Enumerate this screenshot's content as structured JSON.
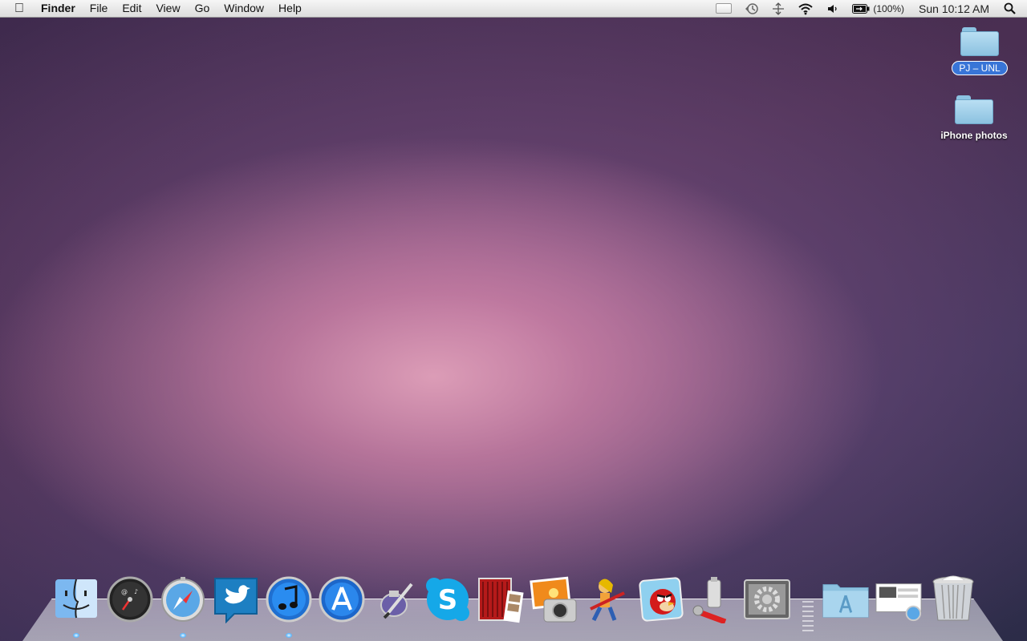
{
  "menubar": {
    "apple_icon": "apple-icon",
    "app_name": "Finder",
    "items": [
      "File",
      "Edit",
      "View",
      "Go",
      "Window",
      "Help"
    ],
    "status": {
      "battery_percent": "(100%)",
      "clock": "Sun 10:12 AM"
    }
  },
  "desktop": {
    "icons": [
      {
        "label": "PJ – UNL",
        "selected": true
      },
      {
        "label": "iPhone photos",
        "selected": false
      }
    ]
  },
  "dock": {
    "items": [
      {
        "name": "finder-icon",
        "running": true
      },
      {
        "name": "dashboard-icon",
        "running": false
      },
      {
        "name": "safari-icon",
        "running": true
      },
      {
        "name": "twitter-icon",
        "running": false
      },
      {
        "name": "itunes-icon",
        "running": true
      },
      {
        "name": "app-store-icon",
        "running": false
      },
      {
        "name": "pen-ink-icon",
        "running": false
      },
      {
        "name": "skype-icon",
        "running": false
      },
      {
        "name": "photo-booth-icon",
        "running": false
      },
      {
        "name": "iphoto-icon",
        "running": false
      },
      {
        "name": "guitar-hero-icon",
        "running": false
      },
      {
        "name": "angry-birds-icon",
        "running": false
      },
      {
        "name": "utilities-icon",
        "running": false
      },
      {
        "name": "system-preferences-icon",
        "running": false
      },
      {
        "name": "applications-folder-icon",
        "running": false
      },
      {
        "name": "downloads-stack-icon",
        "running": false
      },
      {
        "name": "trash-icon",
        "running": false
      }
    ]
  },
  "colors": {
    "selection_blue": "#3875d7",
    "folder_blue": "#8cc2e0",
    "indicator_blue": "#5cb8ff"
  }
}
